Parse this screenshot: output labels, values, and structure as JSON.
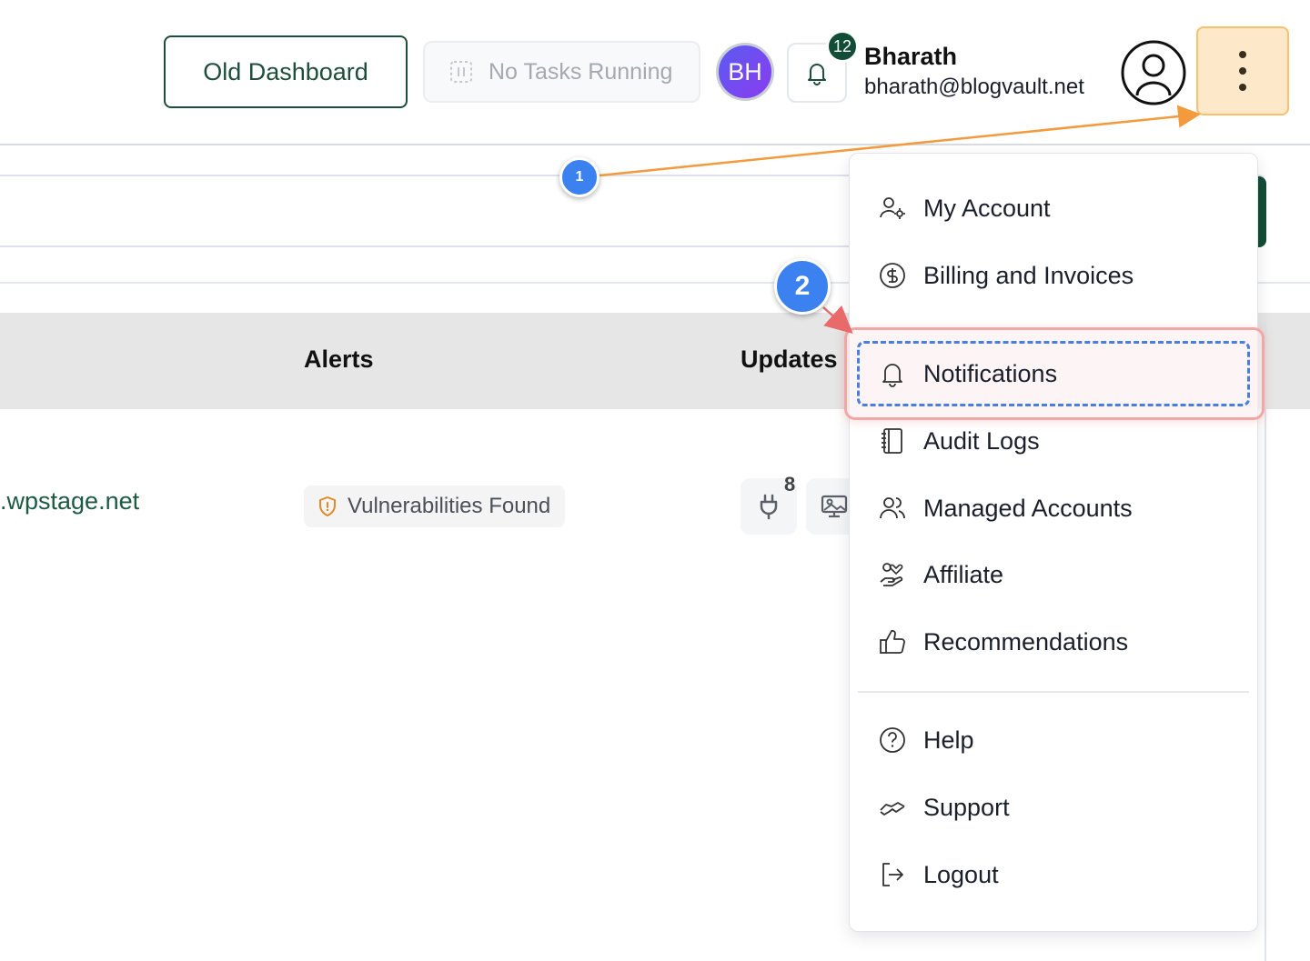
{
  "header": {
    "old_dashboard_label": "Old Dashboard",
    "tasks_label": "No Tasks Running",
    "avatar_initials": "BH",
    "notification_count": "12",
    "user_name": "Bharath",
    "user_email": "bharath@blogvault.net"
  },
  "table": {
    "columns": [
      "Alerts",
      "Updates"
    ],
    "row": {
      "site": ".wpstage.net",
      "alert_badge": "Vulnerabilities Found",
      "plugin_updates": "8"
    }
  },
  "menu": {
    "items": [
      {
        "label": "My Account",
        "icon": "user-gear-icon"
      },
      {
        "label": "Billing and Invoices",
        "icon": "dollar-circle-icon"
      },
      {
        "label": "Notifications",
        "icon": "bell-icon"
      },
      {
        "label": "Audit Logs",
        "icon": "notebook-icon"
      },
      {
        "label": "Managed Accounts",
        "icon": "users-icon"
      },
      {
        "label": "Affiliate",
        "icon": "hand-heart-icon"
      },
      {
        "label": "Recommendations",
        "icon": "thumbs-up-icon"
      },
      {
        "label": "Help",
        "icon": "question-circle-icon"
      },
      {
        "label": "Support",
        "icon": "handshake-icon"
      },
      {
        "label": "Logout",
        "icon": "logout-icon"
      }
    ]
  },
  "annotations": {
    "step_1": "1",
    "step_2": "2"
  },
  "colors": {
    "brand_green": "#124d37",
    "highlight_border": "#f0a7a6",
    "dashed_focus": "#4a7de0",
    "marker_blue": "#3b82f0",
    "arrow_orange": "#f39a3d"
  }
}
